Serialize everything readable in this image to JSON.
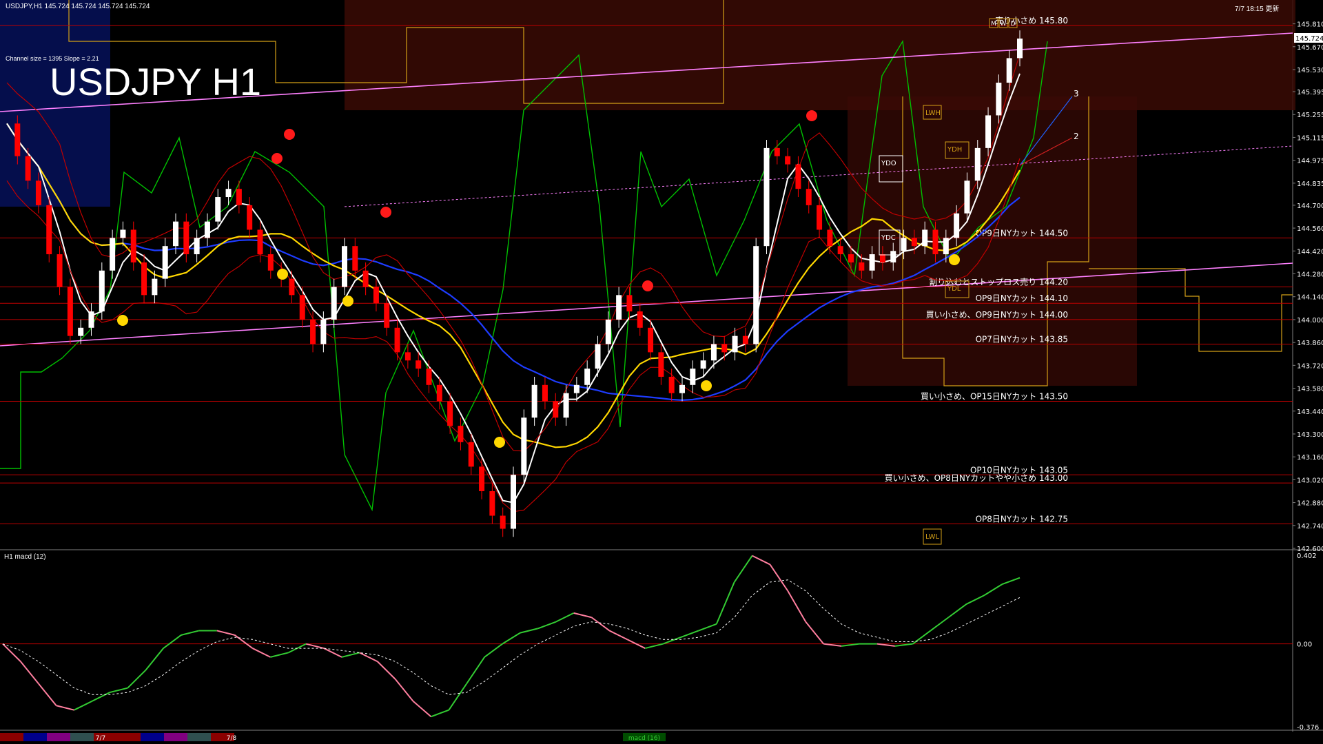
{
  "header": {
    "symbol_ohlc": "USDJPY,H1  145.724 145.724 145.724 145.724",
    "channel_info": "Channel size = 1395 Slope = 2.21",
    "datetime": "7/7 18:15 更新"
  },
  "title": "USDJPY H1",
  "subwindow": {
    "label": "H1  macd (12)"
  },
  "colors": {
    "bg": "#000000",
    "bull": "#ffffff",
    "bear": "#ff0000",
    "level": "#c00000",
    "white_ma": "#ffffff",
    "yellow_ma": "#ffd700",
    "blue_ma": "#1e3cff",
    "green": "#00c000",
    "channel": "#ff80ff",
    "macd_up": "#33cc33",
    "macd_down": "#ff7f9f"
  },
  "chart_data": {
    "type": "line",
    "yaxis": {
      "range": [
        142.6,
        145.88
      ],
      "ticks": [
        "145.810",
        "145.670",
        "145.530",
        "145.395",
        "145.255",
        "145.115",
        "144.975",
        "144.835",
        "144.700",
        "144.560",
        "144.420",
        "144.280",
        "144.140",
        "144.000",
        "143.860",
        "143.720",
        "143.580",
        "143.440",
        "143.300",
        "143.160",
        "143.020",
        "142.880",
        "142.740",
        "142.600"
      ]
    },
    "current_price": "145.724",
    "close_series": [
      145.2,
      145.0,
      144.85,
      144.7,
      144.4,
      144.2,
      143.9,
      143.95,
      144.05,
      144.3,
      144.5,
      144.55,
      144.35,
      144.15,
      144.25,
      144.45,
      144.6,
      144.4,
      144.5,
      144.6,
      144.75,
      144.8,
      144.7,
      144.55,
      144.4,
      144.3,
      144.25,
      144.15,
      144.0,
      143.85,
      144.0,
      144.2,
      144.45,
      144.3,
      144.2,
      144.1,
      143.95,
      143.8,
      143.75,
      143.7,
      143.6,
      143.5,
      143.35,
      143.25,
      143.1,
      142.95,
      142.8,
      142.72,
      143.05,
      143.4,
      143.6,
      143.5,
      143.4,
      143.55,
      143.6,
      143.7,
      143.85,
      144.0,
      144.15,
      144.05,
      143.95,
      143.8,
      143.65,
      143.55,
      143.6,
      143.7,
      143.75,
      143.85,
      143.8,
      143.9,
      143.85,
      144.45,
      145.05,
      145.0,
      144.95,
      144.8,
      144.7,
      144.55,
      144.45,
      144.4,
      144.35,
      144.3,
      144.4,
      144.35,
      144.42,
      144.5,
      144.45,
      144.55,
      144.4,
      144.5,
      144.65,
      144.85,
      145.05,
      145.25,
      145.45,
      145.6,
      145.72
    ],
    "levels": [
      {
        "price": 145.8,
        "label": "売り小さめ 145.80"
      },
      {
        "price": 144.5,
        "label": "OP9日NYカット 144.50"
      },
      {
        "price": 144.2,
        "label": "割り込むとストップロス売り 144.20"
      },
      {
        "price": 144.1,
        "label": "OP9日NYカット 144.10"
      },
      {
        "price": 144.0,
        "label": "買い小さめ、OP9日NYカット 144.00"
      },
      {
        "price": 143.85,
        "label": "OP7日NYカット 143.85"
      },
      {
        "price": 143.5,
        "label": "買い小さめ、OP15日NYカット 143.50"
      },
      {
        "price": 143.05,
        "label": "OP10日NYカット 143.05"
      },
      {
        "price": 143.0,
        "label": "買い小さめ、OP8日NYカットやや小さめ 143.00"
      },
      {
        "price": 142.75,
        "label": "OP8日NYカット 142.75"
      }
    ],
    "markers": [
      "LWH",
      "YDH",
      "YDO",
      "YDC",
      "YDL",
      "LWL",
      "M",
      "W",
      "D",
      "2",
      "3"
    ],
    "macd": {
      "range": [
        -0.376,
        0.402
      ],
      "ticks": [
        "0.402",
        "0.00",
        "-0.376"
      ],
      "main": [
        0.0,
        -0.08,
        -0.18,
        -0.28,
        -0.3,
        -0.26,
        -0.22,
        -0.2,
        -0.12,
        -0.02,
        0.04,
        0.06,
        0.06,
        0.04,
        -0.02,
        -0.06,
        -0.04,
        -0.0,
        -0.02,
        -0.06,
        -0.04,
        -0.08,
        -0.16,
        -0.26,
        -0.33,
        -0.3,
        -0.18,
        -0.06,
        0.0,
        0.05,
        0.07,
        0.1,
        0.14,
        0.12,
        0.06,
        0.02,
        -0.02,
        -0.0,
        0.03,
        0.06,
        0.09,
        0.28,
        0.4,
        0.36,
        0.24,
        0.1,
        0.0,
        -0.01,
        0.0,
        0.0,
        -0.01,
        0.0,
        0.06,
        0.12,
        0.18,
        0.22,
        0.27,
        0.3
      ],
      "signal": [
        0.0,
        -0.03,
        -0.08,
        -0.14,
        -0.2,
        -0.23,
        -0.23,
        -0.22,
        -0.19,
        -0.14,
        -0.08,
        -0.03,
        0.01,
        0.03,
        0.02,
        0.0,
        -0.02,
        -0.02,
        -0.02,
        -0.03,
        -0.04,
        -0.05,
        -0.08,
        -0.13,
        -0.19,
        -0.23,
        -0.22,
        -0.17,
        -0.11,
        -0.05,
        0.0,
        0.04,
        0.08,
        0.1,
        0.09,
        0.07,
        0.04,
        0.02,
        0.02,
        0.03,
        0.05,
        0.12,
        0.22,
        0.28,
        0.29,
        0.24,
        0.16,
        0.09,
        0.05,
        0.03,
        0.01,
        0.01,
        0.02,
        0.05,
        0.09,
        0.13,
        0.17,
        0.21
      ]
    },
    "x_labels": [
      "7/7",
      "7/8"
    ],
    "bottom_tag": "macd (16)"
  }
}
